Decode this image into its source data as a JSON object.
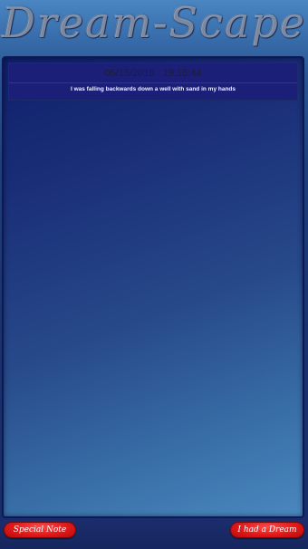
{
  "header": {
    "logo_text": "Dream-Scape"
  },
  "entries": [
    {
      "datetime": "05/15/2018 : 19:15:44",
      "text": "I was falling backwards down a well with sand in my hands"
    }
  ],
  "bottom_bar": {
    "special_note_label": "Special Note",
    "had_dream_label": "I had a Dream"
  },
  "colors": {
    "entry_background": "#1b1f78",
    "button_red": "#e31818"
  }
}
